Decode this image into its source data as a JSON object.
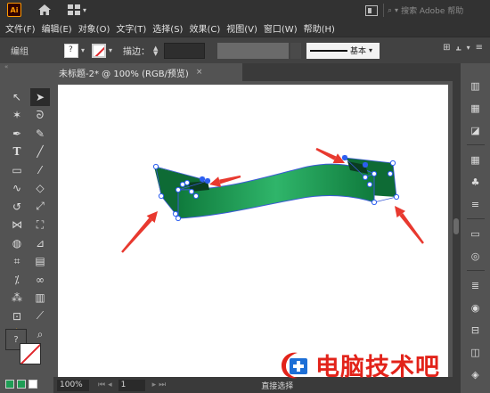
{
  "app": {
    "logo": "Ai"
  },
  "titlebar": {
    "search_placeholder": "搜索 Adobe 帮助"
  },
  "menu": [
    "文件(F)",
    "编辑(E)",
    "对象(O)",
    "文字(T)",
    "选择(S)",
    "效果(C)",
    "视图(V)",
    "窗口(W)",
    "帮助(H)"
  ],
  "control": {
    "group_label": "编组",
    "stroke_label": "描边：",
    "line_style": "基本",
    "fill_hint": "?"
  },
  "document": {
    "tab_title": "未标题-2* @ 100% (RGB/预览)",
    "close": "×"
  },
  "status": {
    "zoom": "100%",
    "page": "1",
    "current_tool": "直接选择"
  },
  "fill_stroke": {
    "fill_hint": "?"
  },
  "colors": {
    "ribbon_dark": "#0f7a3c",
    "ribbon_light": "#2fb56a",
    "arrow": "#e8392f",
    "anchor": "#2d5ff0"
  },
  "watermark": {
    "text": "电脑技术吧"
  }
}
